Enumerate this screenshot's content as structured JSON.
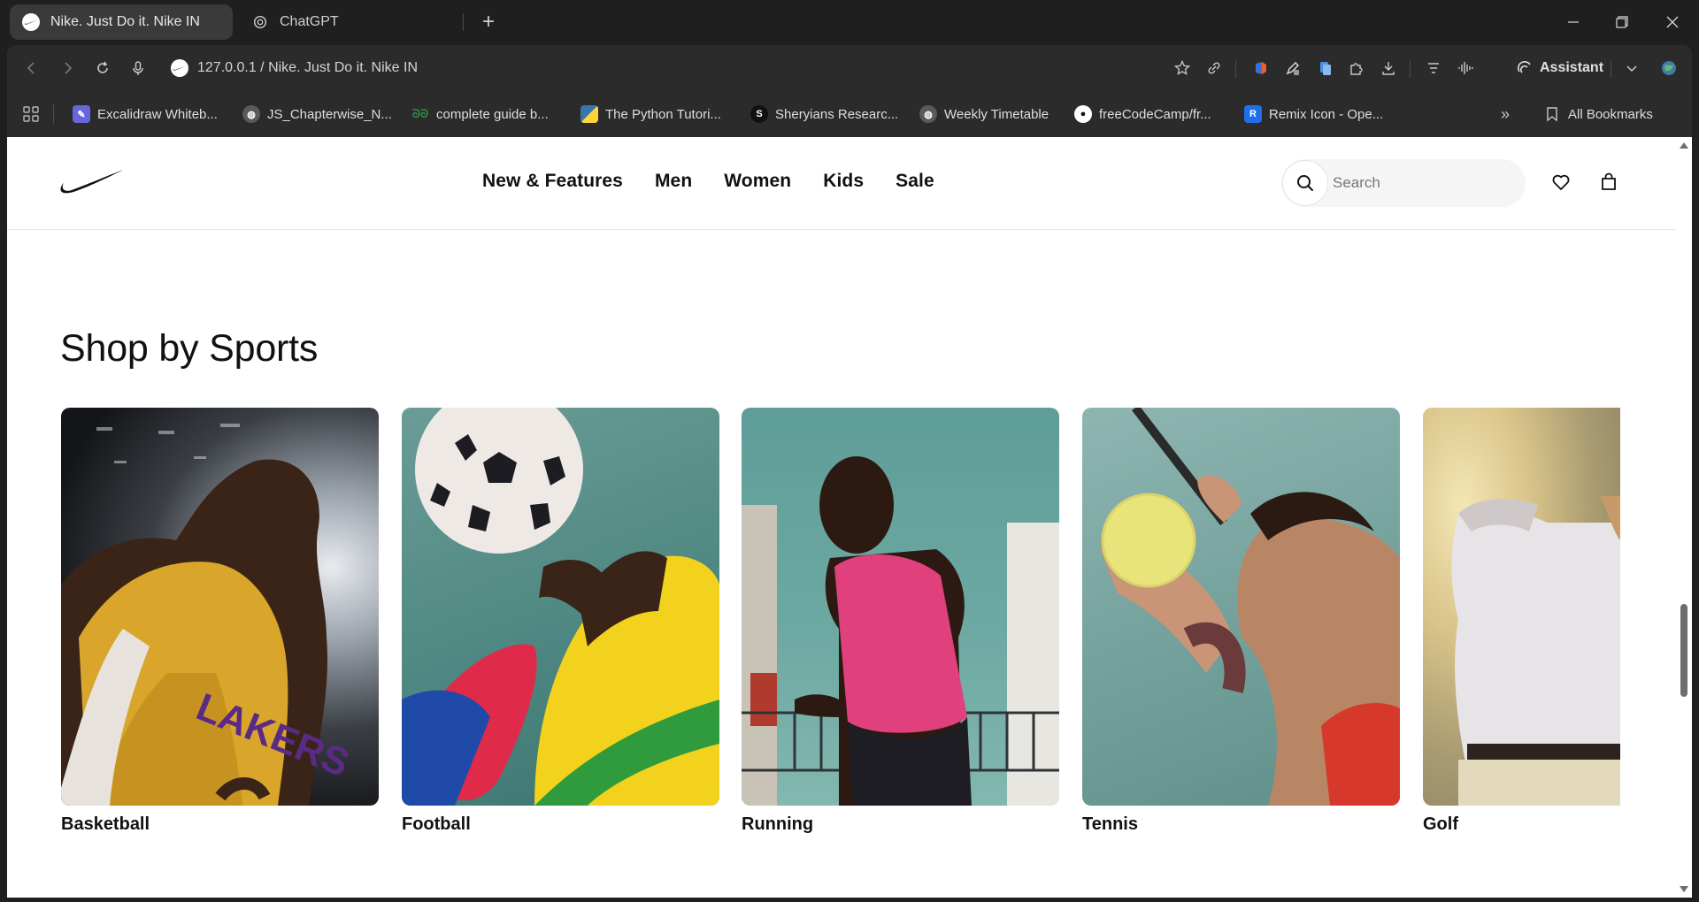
{
  "browser": {
    "tabs": [
      {
        "title": "Nike. Just Do it. Nike IN",
        "active": true
      },
      {
        "title": "ChatGPT",
        "active": false
      }
    ],
    "url": "127.0.0.1 / Nike. Just Do it. Nike IN",
    "assistant_label": "Assistant",
    "bookmarks": [
      {
        "label": "Excalidraw Whiteb...",
        "icon": "excalidraw-icon"
      },
      {
        "label": "JS_Chapterwise_N...",
        "icon": "globe-icon"
      },
      {
        "label": "complete guide b...",
        "icon": "gfg-icon"
      },
      {
        "label": "The Python Tutori...",
        "icon": "python-icon"
      },
      {
        "label": "Sheryians Researc...",
        "icon": "sheryians-icon"
      },
      {
        "label": "Weekly Timetable",
        "icon": "globe-icon"
      },
      {
        "label": "freeCodeCamp/fr...",
        "icon": "github-icon"
      },
      {
        "label": "Remix Icon - Ope...",
        "icon": "remix-icon"
      }
    ],
    "all_bookmarks_label": "All Bookmarks"
  },
  "page": {
    "nav": {
      "links": [
        "New & Features",
        "Men",
        "Women",
        "Kids",
        "Sale"
      ],
      "search_placeholder": "Search"
    },
    "section_title": "Shop by Sports",
    "sports": [
      {
        "label": "Basketball"
      },
      {
        "label": "Football"
      },
      {
        "label": "Running"
      },
      {
        "label": "Tennis"
      },
      {
        "label": "Golf"
      }
    ]
  },
  "colors": {
    "chrome_bg": "#1f1f1f",
    "toolbar_bg": "#2b2b2b",
    "page_bg": "#ffffff",
    "text": "#111111"
  }
}
